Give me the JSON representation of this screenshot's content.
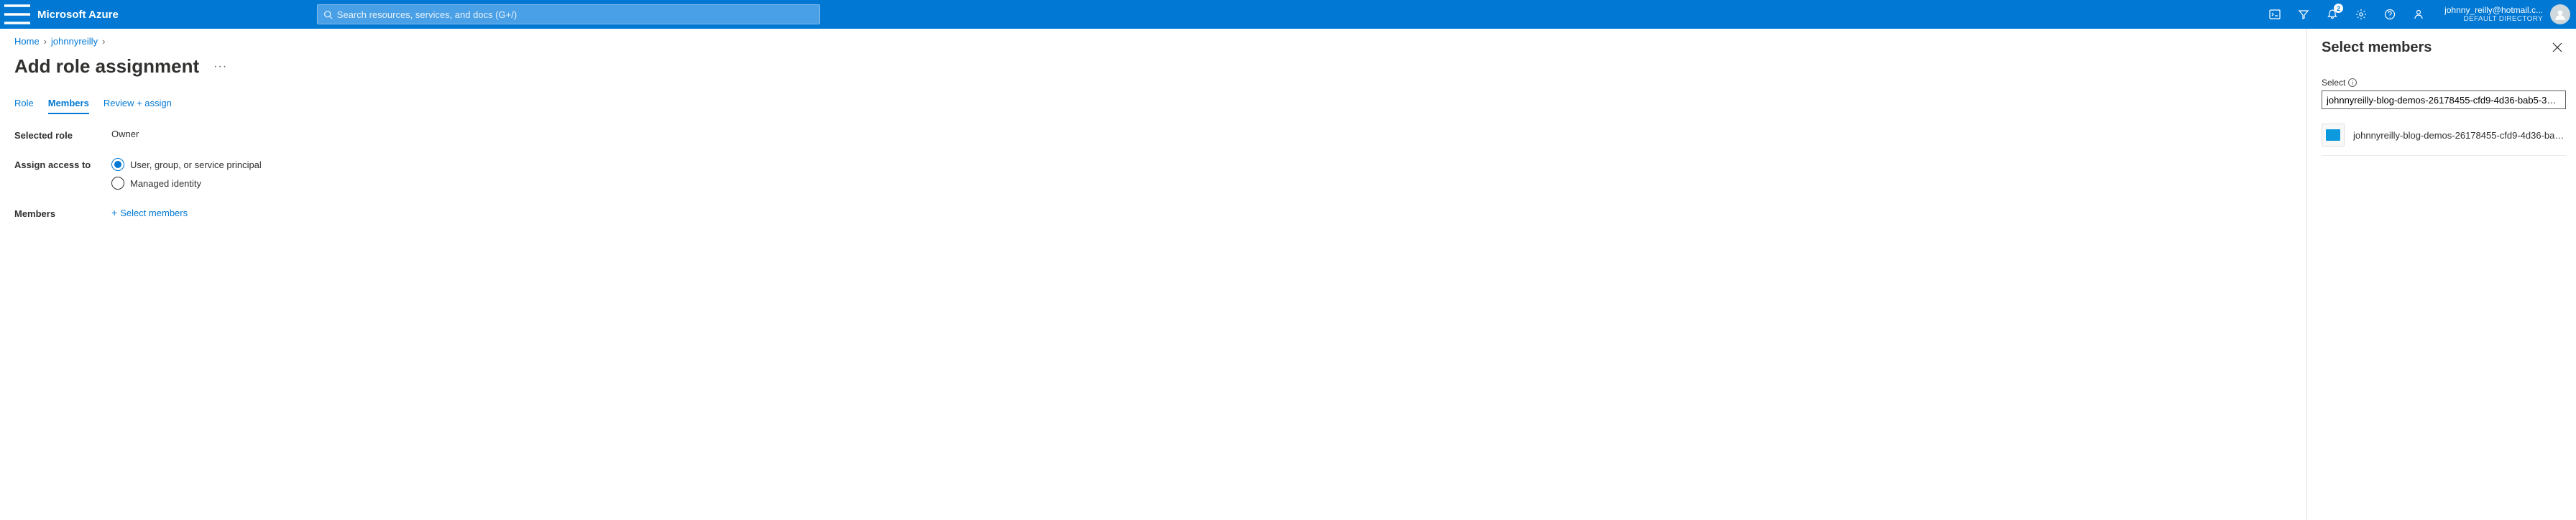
{
  "header": {
    "brand": "Microsoft Azure",
    "search_placeholder": "Search resources, services, and docs (G+/)",
    "notification_count": "2",
    "account_email": "johnny_reilly@hotmail.c...",
    "account_directory": "DEFAULT DIRECTORY"
  },
  "breadcrumb": {
    "items": [
      "Home",
      "johnnyreilly"
    ]
  },
  "page": {
    "title": "Add role assignment"
  },
  "tabs": {
    "items": [
      "Role",
      "Members",
      "Review + assign"
    ],
    "active_index": 1
  },
  "form": {
    "selected_role_label": "Selected role",
    "selected_role_value": "Owner",
    "assign_access_label": "Assign access to",
    "radio_user": "User, group, or service principal",
    "radio_managed": "Managed identity",
    "members_label": "Members",
    "select_members_link": "Select members"
  },
  "panel": {
    "title": "Select members",
    "select_label": "Select",
    "search_value": "johnnyreilly-blog-demos-26178455-cfd9-4d36-bab5-35896b6...",
    "results": [
      {
        "name": "johnnyreilly-blog-demos-26178455-cfd9-4d36-bab5-358"
      }
    ]
  }
}
